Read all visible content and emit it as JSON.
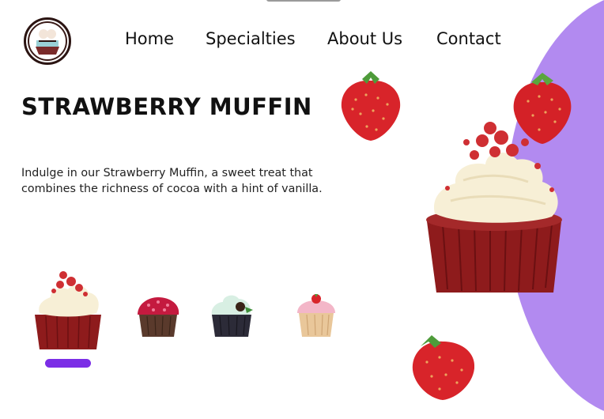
{
  "nav": {
    "items": [
      "Home",
      "Specialties",
      "About Us",
      "Contact"
    ]
  },
  "hero": {
    "title": "STRAWBERRY MUFFIN",
    "description": "Indulge in our Strawberry Muffin, a sweet treat that combines the richness of cocoa with a hint of vanilla."
  },
  "logo": {
    "icon": "bakery-logo-icon"
  },
  "carousel": {
    "items": [
      {
        "name": "red velvet cupcake",
        "icon": "cupcake-icon"
      },
      {
        "name": "raspberry cupcake",
        "icon": "cupcake-icon"
      },
      {
        "name": "mint chocolate cupcake",
        "icon": "cupcake-icon"
      },
      {
        "name": "vanilla strawberry cupcake",
        "icon": "cupcake-icon"
      }
    ],
    "active_index": 0
  },
  "colors": {
    "accent": "#b28af0",
    "indicator": "#7b2ee6",
    "text": "#111111"
  }
}
